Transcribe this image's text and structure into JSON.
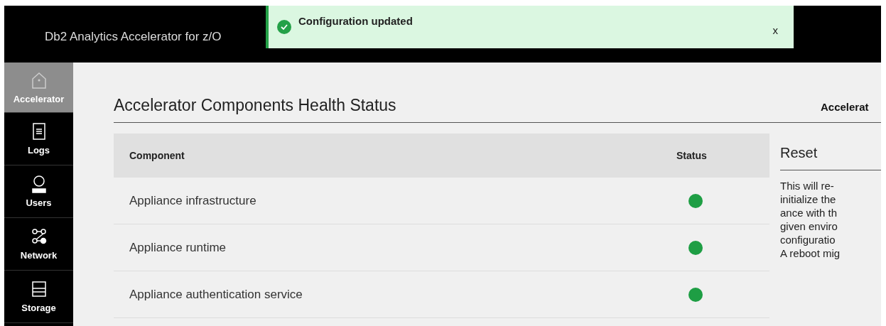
{
  "header": {
    "title": "Db2 Analytics Accelerator for z/O"
  },
  "notification": {
    "kind": "success",
    "message": "Configuration updated",
    "close": "x"
  },
  "sidebar": {
    "items": [
      {
        "label": "Accelerator",
        "selected": true
      },
      {
        "label": "Logs",
        "selected": false
      },
      {
        "label": "Users",
        "selected": false
      },
      {
        "label": "Network",
        "selected": false
      },
      {
        "label": "Storage",
        "selected": false
      }
    ]
  },
  "page": {
    "title": "Accelerator Components Health Status",
    "right_heading": "Accelerat"
  },
  "table": {
    "columns": [
      "Component",
      "Status"
    ],
    "rows": [
      {
        "component": "Appliance infrastructure",
        "color": "#1e9e44"
      },
      {
        "component": "Appliance runtime",
        "color": "#1e9e44"
      },
      {
        "component": "Appliance authentication service",
        "color": "#1e9e44"
      }
    ]
  },
  "reset": {
    "title": "Reset",
    "lines": [
      "This will re-",
      "initialize the",
      "ance with th",
      "given enviro",
      "configuratio",
      "A reboot mig"
    ]
  }
}
